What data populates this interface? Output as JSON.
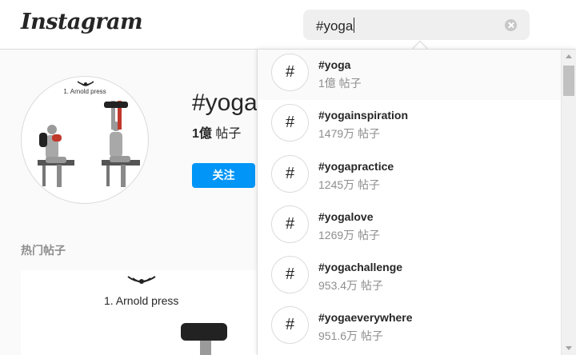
{
  "header": {
    "logo_text": "Instagram",
    "search_value": "#yoga"
  },
  "hashtag_page": {
    "title": "#yoga",
    "posts_count": "1億",
    "posts_label": "帖子",
    "follow_label": "关注",
    "top_posts_label": "热门帖子",
    "avatar_caption": "1. Arnold press",
    "post_caption": "1. Arnold press"
  },
  "dropdown": {
    "hash_symbol": "#",
    "items": [
      {
        "name": "#yoga",
        "count": "1億 帖子"
      },
      {
        "name": "#yogainspiration",
        "count": "1479万 帖子"
      },
      {
        "name": "#yogapractice",
        "count": "1245万 帖子"
      },
      {
        "name": "#yogalove",
        "count": "1269万 帖子"
      },
      {
        "name": "#yogachallenge",
        "count": "953.4万 帖子"
      },
      {
        "name": "#yogaeverywhere",
        "count": "951.6万 帖子"
      }
    ]
  },
  "colors": {
    "accent": "#0095f6",
    "muted_text": "#8e8e8e",
    "border": "#dbdbdb"
  },
  "icons": {
    "search_clear": "clear-icon",
    "hashtag": "hashtag-icon"
  }
}
